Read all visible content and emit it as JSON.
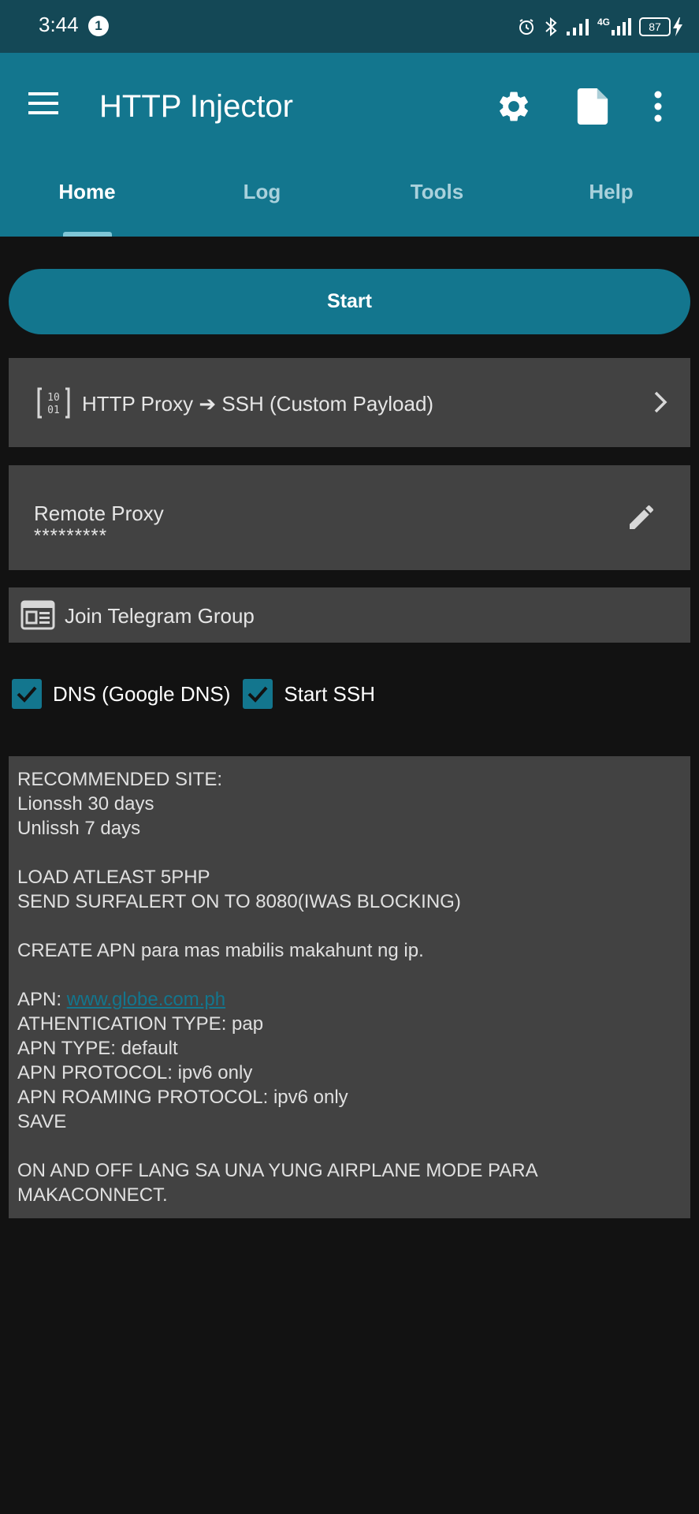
{
  "status_bar": {
    "time": "3:44",
    "notification_count": "1",
    "network_type": "4G",
    "battery_level": "87"
  },
  "app": {
    "title": "HTTP Injector",
    "accent_color": "#13768e",
    "statusbar_color": "#144856",
    "toolbar_icons": [
      "gear-icon",
      "file-icon",
      "more-vert-icon"
    ]
  },
  "tabs": [
    {
      "label": "Home",
      "active": true
    },
    {
      "label": "Log",
      "active": false
    },
    {
      "label": "Tools",
      "active": false
    },
    {
      "label": "Help",
      "active": false
    }
  ],
  "start_button": {
    "label": "Start"
  },
  "mode": {
    "label": "HTTP Proxy ➔ SSH (Custom Payload)"
  },
  "remote_proxy": {
    "title": "Remote Proxy",
    "value": "*********"
  },
  "telegram": {
    "label": "Join Telegram Group"
  },
  "options": [
    {
      "label": "DNS (Google DNS)",
      "checked": true
    },
    {
      "label": "Start SSH",
      "checked": true
    }
  ],
  "notes": {
    "line1": "RECOMMENDED SITE:",
    "line2": "Lionssh 30 days",
    "line3": "Unlissh 7 days",
    "line4": "LOAD ATLEAST 5PHP",
    "line5": "SEND SURFALERT ON TO 8080(IWAS BLOCKING)",
    "line6": "CREATE APN para mas mabilis makahunt ng ip.",
    "apn_prefix": "APN: ",
    "apn_link": "www.globe.com.ph",
    "line8": "ATHENTICATION TYPE: pap",
    "line9": "APN TYPE: default",
    "line10": "APN PROTOCOL: ipv6 only",
    "line11": "APN ROAMING PROTOCOL: ipv6 only",
    "line12": "SAVE",
    "line13": "ON AND OFF LANG SA UNA YUNG AIRPLANE MODE PARA",
    "line14": "MAKACONNECT."
  }
}
